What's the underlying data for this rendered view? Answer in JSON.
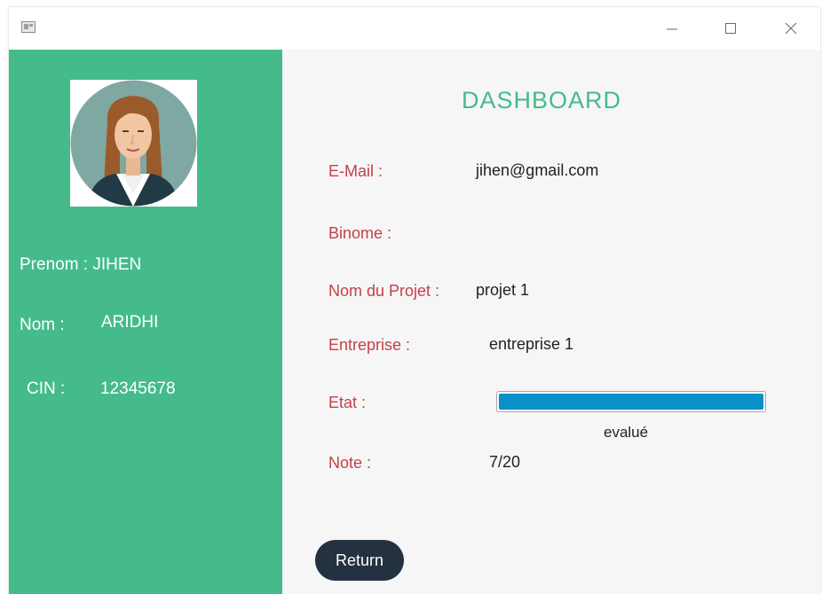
{
  "window": {
    "controls": {
      "minimize_icon": "minimize-icon",
      "maximize_icon": "maximize-icon",
      "close_icon": "close-icon"
    }
  },
  "colors": {
    "sidebar": "#45bb8b",
    "title": "#45bb8b",
    "label": "#c4404a",
    "progress": "#0a90c8",
    "button": "#243140"
  },
  "sidebar": {
    "avatar_icon": "woman-avatar-icon",
    "prenom_label": "Prenom :",
    "prenom_value": "JIHEN",
    "nom_label": "Nom :",
    "nom_value": "ARIDHI",
    "cin_label": "CIN :",
    "cin_value": "12345678"
  },
  "main": {
    "title": "DASHBOARD",
    "email_label": "E-Mail :",
    "email_value": "jihen@gmail.com",
    "binome_label": "Binome :",
    "binome_value": "",
    "projet_label": "Nom du Projet :",
    "projet_value": "projet 1",
    "entreprise_label": "Entreprise :",
    "entreprise_value": "entreprise 1",
    "etat_label": "Etat :",
    "etat_progress": 1.0,
    "etat_status": "evalué",
    "note_label": "Note :",
    "note_value": "7/20",
    "return_label": "Return"
  }
}
